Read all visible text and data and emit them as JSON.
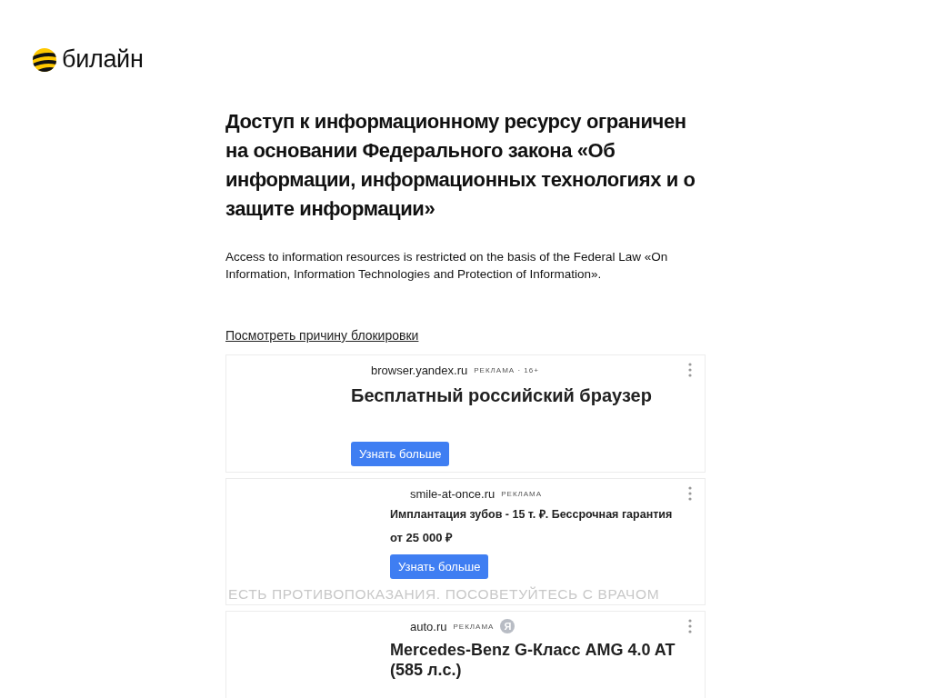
{
  "logo": {
    "text": "билайн"
  },
  "heading": "Доступ к информационному ресурсу ограничен на основании Федерального закона «Об информации, информационных технологиях и о защите информации»",
  "description": "Access to information resources is restricted on the basis of the Federal Law «On Information, Information Technologies and Protection of Information».",
  "reason_link": "Посмотреть причину блокировки",
  "ads": [
    {
      "kind": "hero",
      "domain": "browser.yandex.ru",
      "label": "РЕКЛАМА · 16+",
      "title": "Бесплатный российский браузер",
      "button": "Узнать больше"
    },
    {
      "kind": "compact",
      "domain": "smile-at-once.ru",
      "label": "РЕКЛАМА",
      "title": "Имплантация зубов - 15 т. ₽. Бессрочная гарантия",
      "subtitle": "от 25 000 ₽",
      "button": "Узнать больше",
      "disclaimer": "ЕСТЬ ПРОТИВОПОКАЗАНИЯ. ПОСОВЕТУЙТЕСЬ С ВРАЧОМ"
    },
    {
      "kind": "large",
      "domain": "auto.ru",
      "label": "РЕКЛАМА",
      "badge": "Я",
      "title": "Mercedes-Benz G-Класс AMG 4.0 AT (585 л.с.)"
    }
  ]
}
